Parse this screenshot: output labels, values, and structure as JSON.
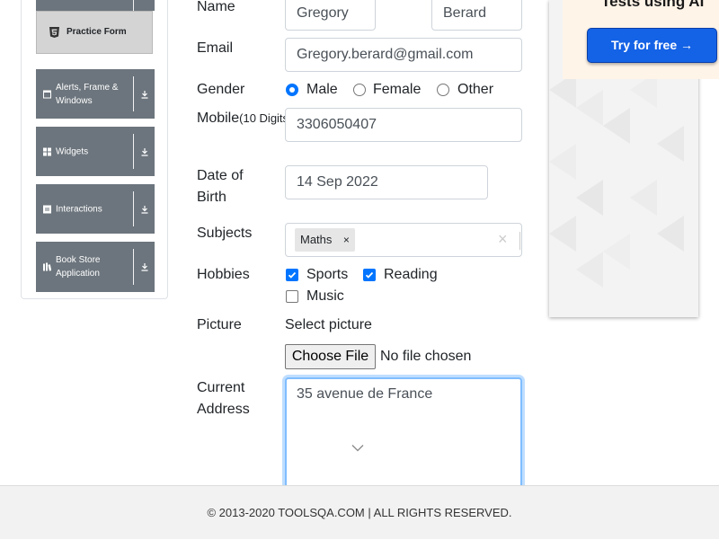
{
  "sidebar": {
    "practice_form_label": "Practice Form",
    "groups": [
      {
        "label": "Alerts, Frame & Windows",
        "icon": "window-icon"
      },
      {
        "label": "Widgets",
        "icon": "grid-icon"
      },
      {
        "label": "Interactions",
        "icon": "list-icon"
      },
      {
        "label": "Book Store Application",
        "icon": "book-icon"
      }
    ]
  },
  "form": {
    "name_label": "Name",
    "first_name": "Gregory",
    "last_name": "Berard",
    "email_label": "Email",
    "email": "Gregory.berard@gmail.com",
    "gender_label": "Gender",
    "gender_options": [
      "Male",
      "Female",
      "Other"
    ],
    "gender_selected": "Male",
    "mobile_label": "Mobile",
    "mobile_hint": "(10 Digits)",
    "mobile": "3306050407",
    "dob_label_line1": "Date of",
    "dob_label_line2": "Birth",
    "dob": "14 Sep 2022",
    "subjects_label": "Subjects",
    "subjects": [
      "Maths"
    ],
    "subject_remove_glyph": "×",
    "subjects_clear_glyph": "×",
    "hobbies_label": "Hobbies",
    "hobbies": [
      {
        "label": "Sports",
        "checked": true
      },
      {
        "label": "Reading",
        "checked": true
      },
      {
        "label": "Music",
        "checked": false
      }
    ],
    "picture_label": "Picture",
    "select_picture": "Select picture",
    "choose_file": "Choose File",
    "no_file": "No file chosen",
    "address_label_line1": "Current",
    "address_label_line2": "Address",
    "current_address": "35 avenue de France"
  },
  "ad": {
    "headline": "Tests using AI",
    "button": "Try for free →"
  },
  "footer": {
    "text": "© 2013-2020 TOOLSQA.COM | ALL RIGHTS RESERVED."
  },
  "colors": {
    "accent": "#0075ff",
    "sidebar_group": "#6c757d",
    "focus_border": "#80bdff",
    "ad_button": "#1462e6"
  }
}
